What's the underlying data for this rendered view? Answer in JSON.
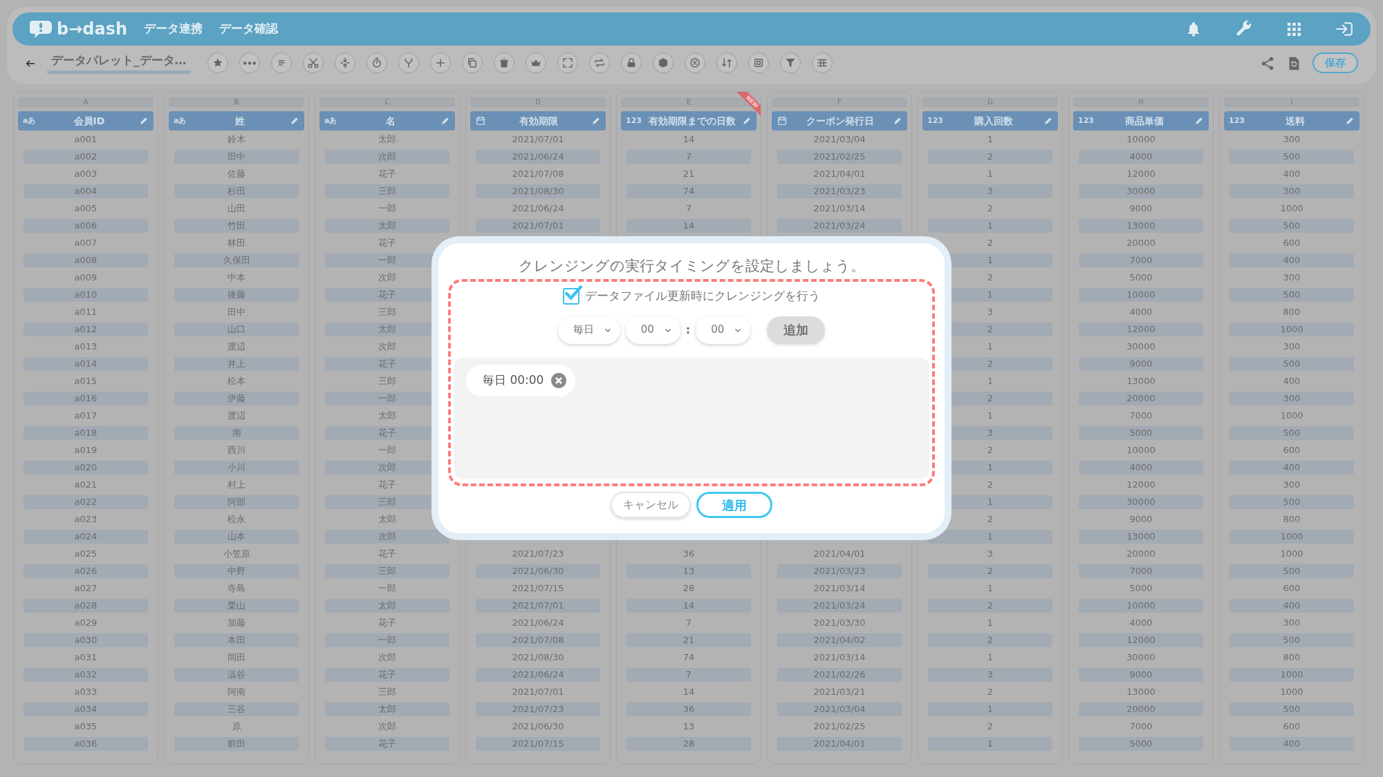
{
  "app": {
    "logo": "b→dash",
    "menu": [
      {
        "label": "データ連携"
      },
      {
        "label": "データ確認"
      }
    ]
  },
  "toolbar": {
    "title": "データパレット_データ…",
    "save": "保存"
  },
  "columns": [
    {
      "letter": "A",
      "label": "会員ID",
      "kind": "text",
      "type_label": "aあ"
    },
    {
      "letter": "B",
      "label": "姓",
      "kind": "text",
      "type_label": "aあ"
    },
    {
      "letter": "C",
      "label": "名",
      "kind": "text",
      "type_label": "aあ"
    },
    {
      "letter": "D",
      "label": "有効期限",
      "kind": "date"
    },
    {
      "letter": "E",
      "label": "有効期限までの日数",
      "kind": "number",
      "type_label": "123",
      "badge": "NEW"
    },
    {
      "letter": "F",
      "label": "クーポン発行日",
      "kind": "date"
    },
    {
      "letter": "G",
      "label": "購入回数",
      "kind": "number",
      "type_label": "123"
    },
    {
      "letter": "H",
      "label": "商品単価",
      "kind": "number",
      "type_label": "123"
    },
    {
      "letter": "I",
      "label": "送料",
      "kind": "number",
      "type_label": "123"
    }
  ],
  "rows": [
    [
      "a001",
      "鈴木",
      "太郎",
      "2021/07/01",
      "14",
      "2021/03/04",
      "1",
      "10000",
      "300"
    ],
    [
      "a002",
      "田中",
      "次郎",
      "2021/06/24",
      "7",
      "2021/02/25",
      "2",
      "4000",
      "500"
    ],
    [
      "a003",
      "佐藤",
      "花子",
      "2021/07/08",
      "21",
      "2021/04/01",
      "1",
      "12000",
      "400"
    ],
    [
      "a004",
      "杉田",
      "三郎",
      "2021/08/30",
      "74",
      "2021/03/23",
      "3",
      "30000",
      "300"
    ],
    [
      "a005",
      "山田",
      "一郎",
      "2021/06/24",
      "7",
      "2021/03/14",
      "2",
      "9000",
      "1000"
    ],
    [
      "a006",
      "竹田",
      "太郎",
      "2021/07/01",
      "14",
      "2021/03/24",
      "1",
      "13000",
      "500"
    ],
    [
      "a007",
      "林田",
      "花子",
      null,
      null,
      null,
      "2",
      "20000",
      "600"
    ],
    [
      "a008",
      "久保田",
      "一郎",
      null,
      null,
      null,
      "1",
      "7000",
      "400"
    ],
    [
      "a009",
      "中本",
      "次郎",
      null,
      null,
      null,
      "2",
      "5000",
      "300"
    ],
    [
      "a010",
      "後藤",
      "花子",
      null,
      null,
      null,
      "1",
      "10000",
      "500"
    ],
    [
      "a011",
      "田中",
      "三郎",
      null,
      null,
      null,
      "3",
      "4000",
      "800"
    ],
    [
      "a012",
      "山口",
      "太郎",
      null,
      null,
      null,
      "2",
      "12000",
      "1000"
    ],
    [
      "a013",
      "渡辺",
      "次郎",
      null,
      null,
      null,
      "1",
      "30000",
      "300"
    ],
    [
      "a014",
      "井上",
      "花子",
      null,
      null,
      null,
      "2",
      "9000",
      "500"
    ],
    [
      "a015",
      "松本",
      "三郎",
      null,
      null,
      null,
      "1",
      "13000",
      "400"
    ],
    [
      "a016",
      "伊藤",
      "一郎",
      null,
      null,
      null,
      "2",
      "20000",
      "300"
    ],
    [
      "a017",
      "渡辺",
      "太郎",
      null,
      null,
      null,
      "1",
      "7000",
      "1000"
    ],
    [
      "a018",
      "南",
      "花子",
      null,
      null,
      null,
      "3",
      "5000",
      "500"
    ],
    [
      "a019",
      "西川",
      "一郎",
      null,
      null,
      null,
      "2",
      "10000",
      "600"
    ],
    [
      "a020",
      "小川",
      "次郎",
      null,
      null,
      null,
      "1",
      "4000",
      "400"
    ],
    [
      "a021",
      "村上",
      "花子",
      null,
      null,
      null,
      "2",
      "12000",
      "300"
    ],
    [
      "a022",
      "阿部",
      "三郎",
      null,
      null,
      null,
      "1",
      "30000",
      "500"
    ],
    [
      "a023",
      "松永",
      "太郎",
      null,
      null,
      null,
      "2",
      "9000",
      "800"
    ],
    [
      "a024",
      "山本",
      "次郎",
      null,
      null,
      null,
      "1",
      "13000",
      "1000"
    ],
    [
      "a025",
      "小笠原",
      "花子",
      "2021/07/23",
      "36",
      "2021/04/01",
      "3",
      "20000",
      "1000"
    ],
    [
      "a026",
      "中野",
      "三郎",
      "2021/06/30",
      "13",
      "2021/03/23",
      "2",
      "7000",
      "500"
    ],
    [
      "a027",
      "寺島",
      "一郎",
      "2021/07/15",
      "28",
      "2021/03/14",
      "1",
      "5000",
      "600"
    ],
    [
      "a028",
      "栗山",
      "太郎",
      "2021/07/01",
      "14",
      "2021/03/24",
      "2",
      "10000",
      "400"
    ],
    [
      "a029",
      "加藤",
      "花子",
      "2021/06/24",
      "7",
      "2021/03/30",
      "1",
      "4000",
      "300"
    ],
    [
      "a030",
      "本田",
      "一郎",
      "2021/07/08",
      "21",
      "2021/04/02",
      "2",
      "12000",
      "500"
    ],
    [
      "a031",
      "岡田",
      "次郎",
      "2021/08/30",
      "74",
      "2021/03/14",
      "1",
      "30000",
      "800"
    ],
    [
      "a032",
      "澁谷",
      "花子",
      "2021/06/24",
      "7",
      "2021/02/26",
      "3",
      "9000",
      "1000"
    ],
    [
      "a033",
      "阿南",
      "三郎",
      "2021/07/01",
      "14",
      "2021/03/21",
      "2",
      "13000",
      "1000"
    ],
    [
      "a034",
      "三谷",
      "太郎",
      "2021/07/23",
      "36",
      "2021/03/04",
      "1",
      "20000",
      "500"
    ],
    [
      "a035",
      "原",
      "次郎",
      "2021/06/30",
      "13",
      "2021/02/25",
      "2",
      "7000",
      "600"
    ],
    [
      "a036",
      "前田",
      "花子",
      "2021/07/15",
      "28",
      "2021/04/01",
      "1",
      "5000",
      "400"
    ]
  ],
  "dialog": {
    "title": "クレンジングの実行タイミングを設定しましょう。",
    "option": {
      "label": "データファイル更新時にクレンジングを行う",
      "checked": true
    },
    "frequency": {
      "value": "毎日"
    },
    "hour": {
      "value": "00"
    },
    "separator": ":",
    "minute": {
      "value": "00"
    },
    "add_button": {
      "label": "追加",
      "disabled": true
    },
    "schedules": [
      {
        "label": "毎日 00:00"
      }
    ],
    "buttons": [
      {
        "label": "キャンセル",
        "kind": "secondary"
      },
      {
        "label": "適用",
        "kind": "primary"
      }
    ]
  }
}
